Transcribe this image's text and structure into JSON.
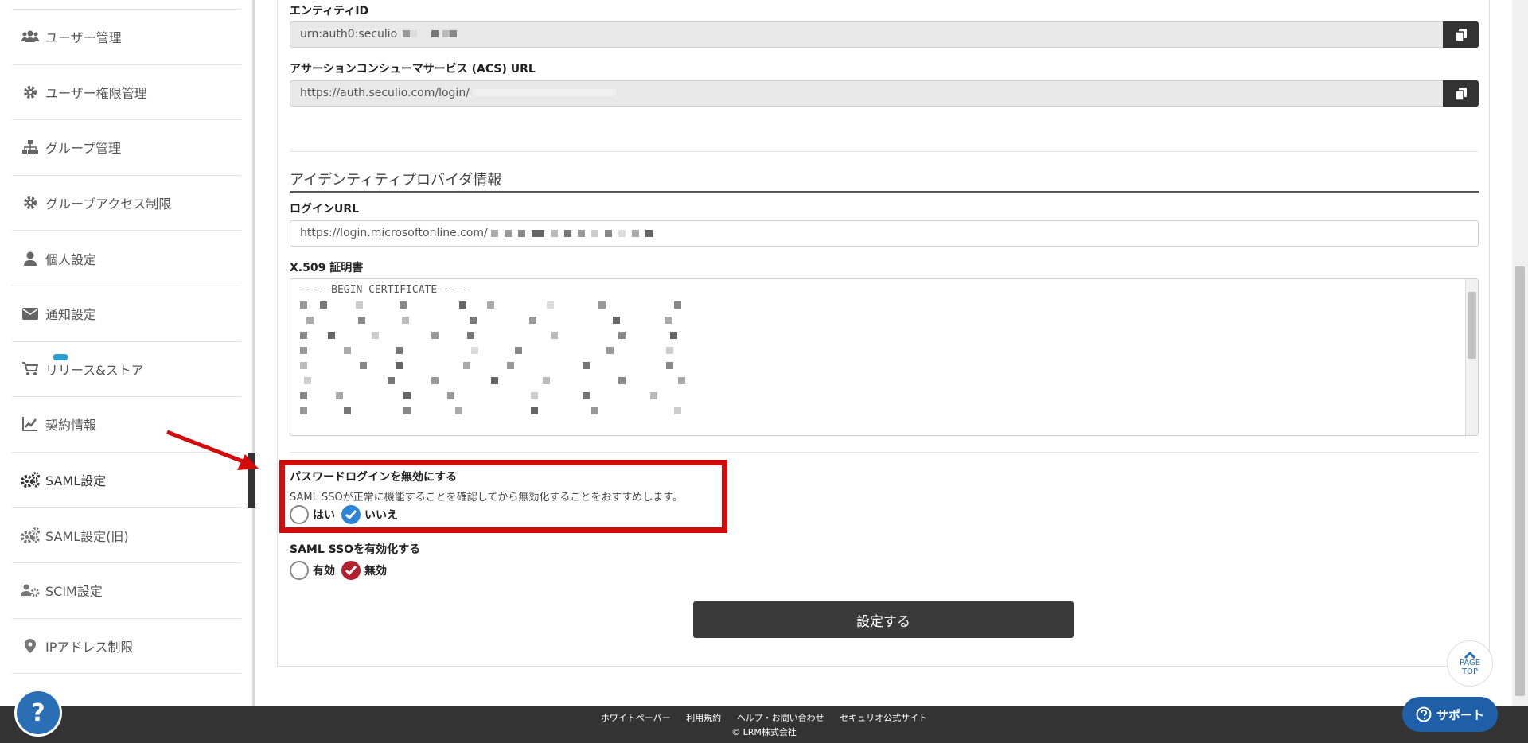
{
  "sidebar": {
    "items": [
      {
        "label": "ユーザー管理",
        "icon": "users-icon"
      },
      {
        "label": "ユーザー権限管理",
        "icon": "gear-icon"
      },
      {
        "label": "グループ管理",
        "icon": "sitemap-icon"
      },
      {
        "label": "グループアクセス制限",
        "icon": "gear-icon"
      },
      {
        "label": "個人設定",
        "icon": "user-icon"
      },
      {
        "label": "通知設定",
        "icon": "envelope-icon"
      },
      {
        "label": "リリース&ストア",
        "icon": "cart-icon"
      },
      {
        "label": "契約情報",
        "icon": "chart-edit-icon"
      },
      {
        "label": "SAML設定",
        "icon": "gears-icon",
        "active": true
      },
      {
        "label": "SAML設定(旧)",
        "icon": "gears-icon"
      },
      {
        "label": "SCIM設定",
        "icon": "users-gear-icon"
      },
      {
        "label": "IPアドレス制限",
        "icon": "map-marker-icon"
      }
    ]
  },
  "sp": {
    "entity_id_label": "エンティティID",
    "entity_id_value": "urn:auth0:seculio",
    "acs_label": "アサーションコンシューマサービス (ACS) URL",
    "acs_value": "https://auth.seculio.com/login/"
  },
  "idp": {
    "section_title": "アイデンティティプロバイダ情報",
    "login_url_label": "ログインURL",
    "login_url_value": "https://login.microsoftonline.com/",
    "cert_label": "X.509 証明書",
    "cert_header": "-----BEGIN CERTIFICATE-----"
  },
  "password_login": {
    "label": "パスワードログインを無効にする",
    "description": "SAML SSOが正常に機能することを確認してから無効化することをおすすめします。",
    "option_yes": "はい",
    "option_no": "いいえ",
    "selected": "いいえ"
  },
  "saml_sso": {
    "label": "SAML SSOを有効化する",
    "option_enable": "有効",
    "option_disable": "無効",
    "selected": "無効"
  },
  "submit_label": "設定する",
  "page_top": {
    "line1": "PAGE",
    "line2": "TOP"
  },
  "footer": {
    "links": [
      "ホワイトペーパー",
      "利用規約",
      "ヘルプ・お問い合わせ",
      "セキュリオ公式サイト"
    ],
    "copyright": "© LRM株式会社"
  },
  "support_label": "サポート",
  "help_label": "?",
  "colors": {
    "highlight": "#d30b0b",
    "check_blue": "#2a85d8",
    "check_red": "#b0222e",
    "footer": "#333333"
  }
}
